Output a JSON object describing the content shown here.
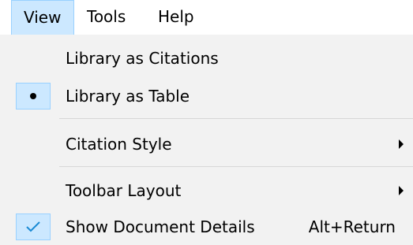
{
  "menubar": {
    "items": [
      {
        "label": "View"
      },
      {
        "label": "Tools"
      },
      {
        "label": "Help"
      }
    ]
  },
  "view_menu": {
    "items": [
      {
        "label": "Library as Citations"
      },
      {
        "label": "Library as Table",
        "selected": true
      },
      {
        "label": "Citation Style",
        "has_submenu": true
      },
      {
        "label": "Toolbar Layout",
        "has_submenu": true
      },
      {
        "label": "Show Document Details",
        "checked": true,
        "shortcut": "Alt+Return"
      }
    ]
  },
  "icons": {
    "selected_indicator": "bullet-icon",
    "checked_indicator": "checkmark-icon",
    "submenu_indicator": "chevron-right-icon"
  },
  "colors": {
    "menu_background": "#f2f2f2",
    "highlight_background": "#cce8ff",
    "highlight_border": "#99d1ff",
    "checkmark": "#1a8ad4",
    "separator": "#d7d7d7"
  }
}
